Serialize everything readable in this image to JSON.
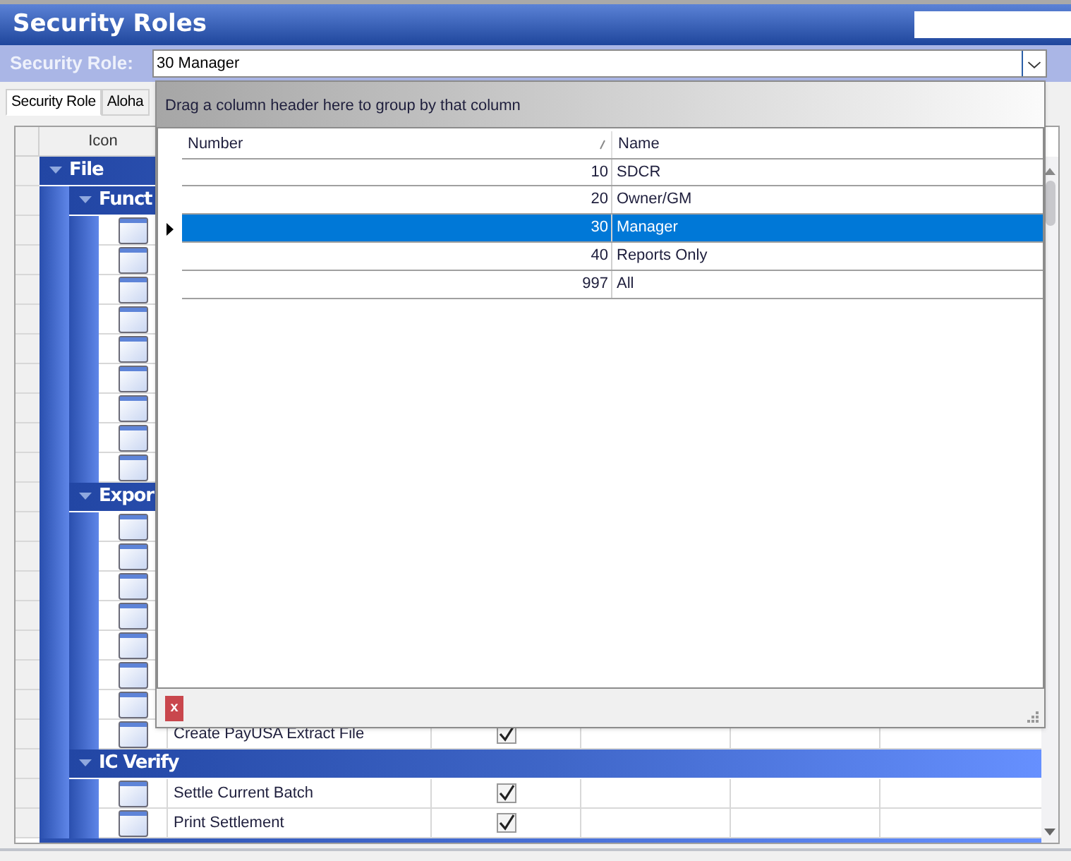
{
  "window": {
    "title": "Security Roles"
  },
  "security_role": {
    "label": "Security Role:",
    "value": "30 Manager"
  },
  "tabs": [
    {
      "label": "Security Role",
      "selected": true
    },
    {
      "label": "Aloha",
      "selected": false
    }
  ],
  "grid": {
    "columns": [
      "Icon"
    ],
    "groups": [
      {
        "title": "File",
        "groups": [
          {
            "title": "Funct",
            "rows": [
              {},
              {},
              {},
              {},
              {},
              {},
              {},
              {},
              {}
            ]
          },
          {
            "title": "Expor",
            "rows": [
              {},
              {},
              {},
              {},
              {},
              {},
              {},
              {
                "name": "Create PayUSA Extract File",
                "checked": true
              }
            ]
          },
          {
            "title": "IC Verify",
            "rows": [
              {
                "name": "Settle Current Batch",
                "checked": true
              },
              {
                "name": "Print Settlement",
                "checked": true
              }
            ]
          }
        ]
      }
    ]
  },
  "dropdown": {
    "group_hint": "Drag a column header here to group by that column",
    "columns": [
      {
        "label": "Number",
        "sorted": true
      },
      {
        "label": "Name",
        "sorted": false
      }
    ],
    "rows": [
      {
        "number": "10",
        "name": "SDCR",
        "selected": false
      },
      {
        "number": "20",
        "name": "Owner/GM",
        "selected": false
      },
      {
        "number": "30",
        "name": "Manager",
        "selected": true
      },
      {
        "number": "40",
        "name": "Reports Only",
        "selected": false
      },
      {
        "number": "997",
        "name": "All",
        "selected": false
      }
    ],
    "close_button": "x"
  }
}
